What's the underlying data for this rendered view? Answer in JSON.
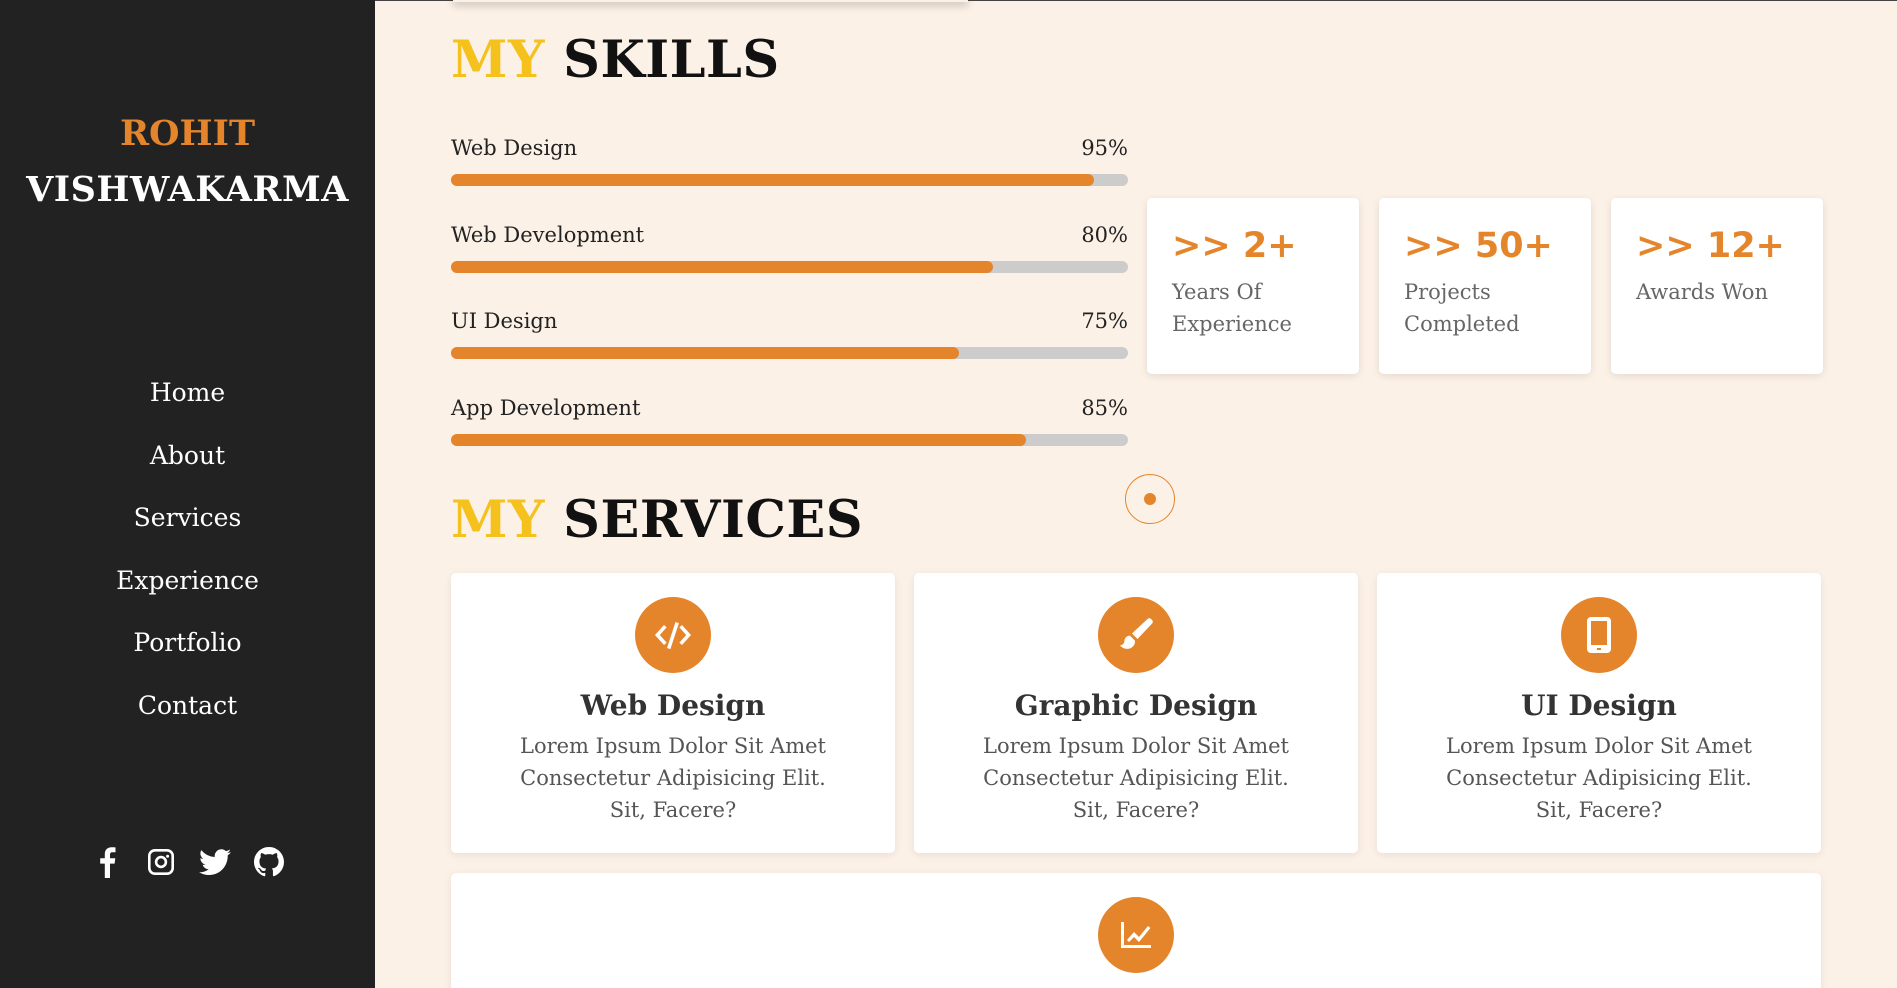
{
  "sidebar": {
    "brand_first": "ROHIT",
    "brand_last": "VISHWAKARMA",
    "nav": [
      "Home",
      "About",
      "Services",
      "Experience",
      "Portfolio",
      "Contact"
    ],
    "social_icons": [
      "facebook-icon",
      "instagram-icon",
      "twitter-icon",
      "github-icon"
    ]
  },
  "skills_section": {
    "title_accent": "MY",
    "title_rest": "SKILLS",
    "skills": [
      {
        "label": "Web Design",
        "percent_text": "95%",
        "percent": 95
      },
      {
        "label": "Web Development",
        "percent_text": "80%",
        "percent": 80
      },
      {
        "label": "UI Design",
        "percent_text": "75%",
        "percent": 75
      },
      {
        "label": "App Development",
        "percent_text": "85%",
        "percent": 85
      }
    ]
  },
  "stats": [
    {
      "value": ">> 2+",
      "label_line1": "Years Of",
      "label_line2": "Experience"
    },
    {
      "value": ">> 50+",
      "label_line1": "Projects",
      "label_line2": "Completed"
    },
    {
      "value": ">> 12+",
      "label_line1": "Awards Won",
      "label_line2": ""
    }
  ],
  "services_section": {
    "title_accent": "MY",
    "title_rest": "SERVICES",
    "services": [
      {
        "icon": "code-icon",
        "title": "Web Design",
        "text": "Lorem Ipsum Dolor Sit Amet Consectetur Adipisicing Elit. Sit, Facere?"
      },
      {
        "icon": "brush-icon",
        "title": "Graphic Design",
        "text": "Lorem Ipsum Dolor Sit Amet Consectetur Adipisicing Elit. Sit, Facere?"
      },
      {
        "icon": "mobile-icon",
        "title": "UI Design",
        "text": "Lorem Ipsum Dolor Sit Amet Consectetur Adipisicing Elit. Sit, Facere?"
      },
      {
        "icon": "chart-line-icon",
        "title": "",
        "text": ""
      }
    ]
  },
  "colors": {
    "accent": "#e5852b",
    "title_accent": "#f5c11d",
    "sidebar_bg": "#222222",
    "page_bg": "#fcf1e7",
    "track": "#cccccc"
  }
}
